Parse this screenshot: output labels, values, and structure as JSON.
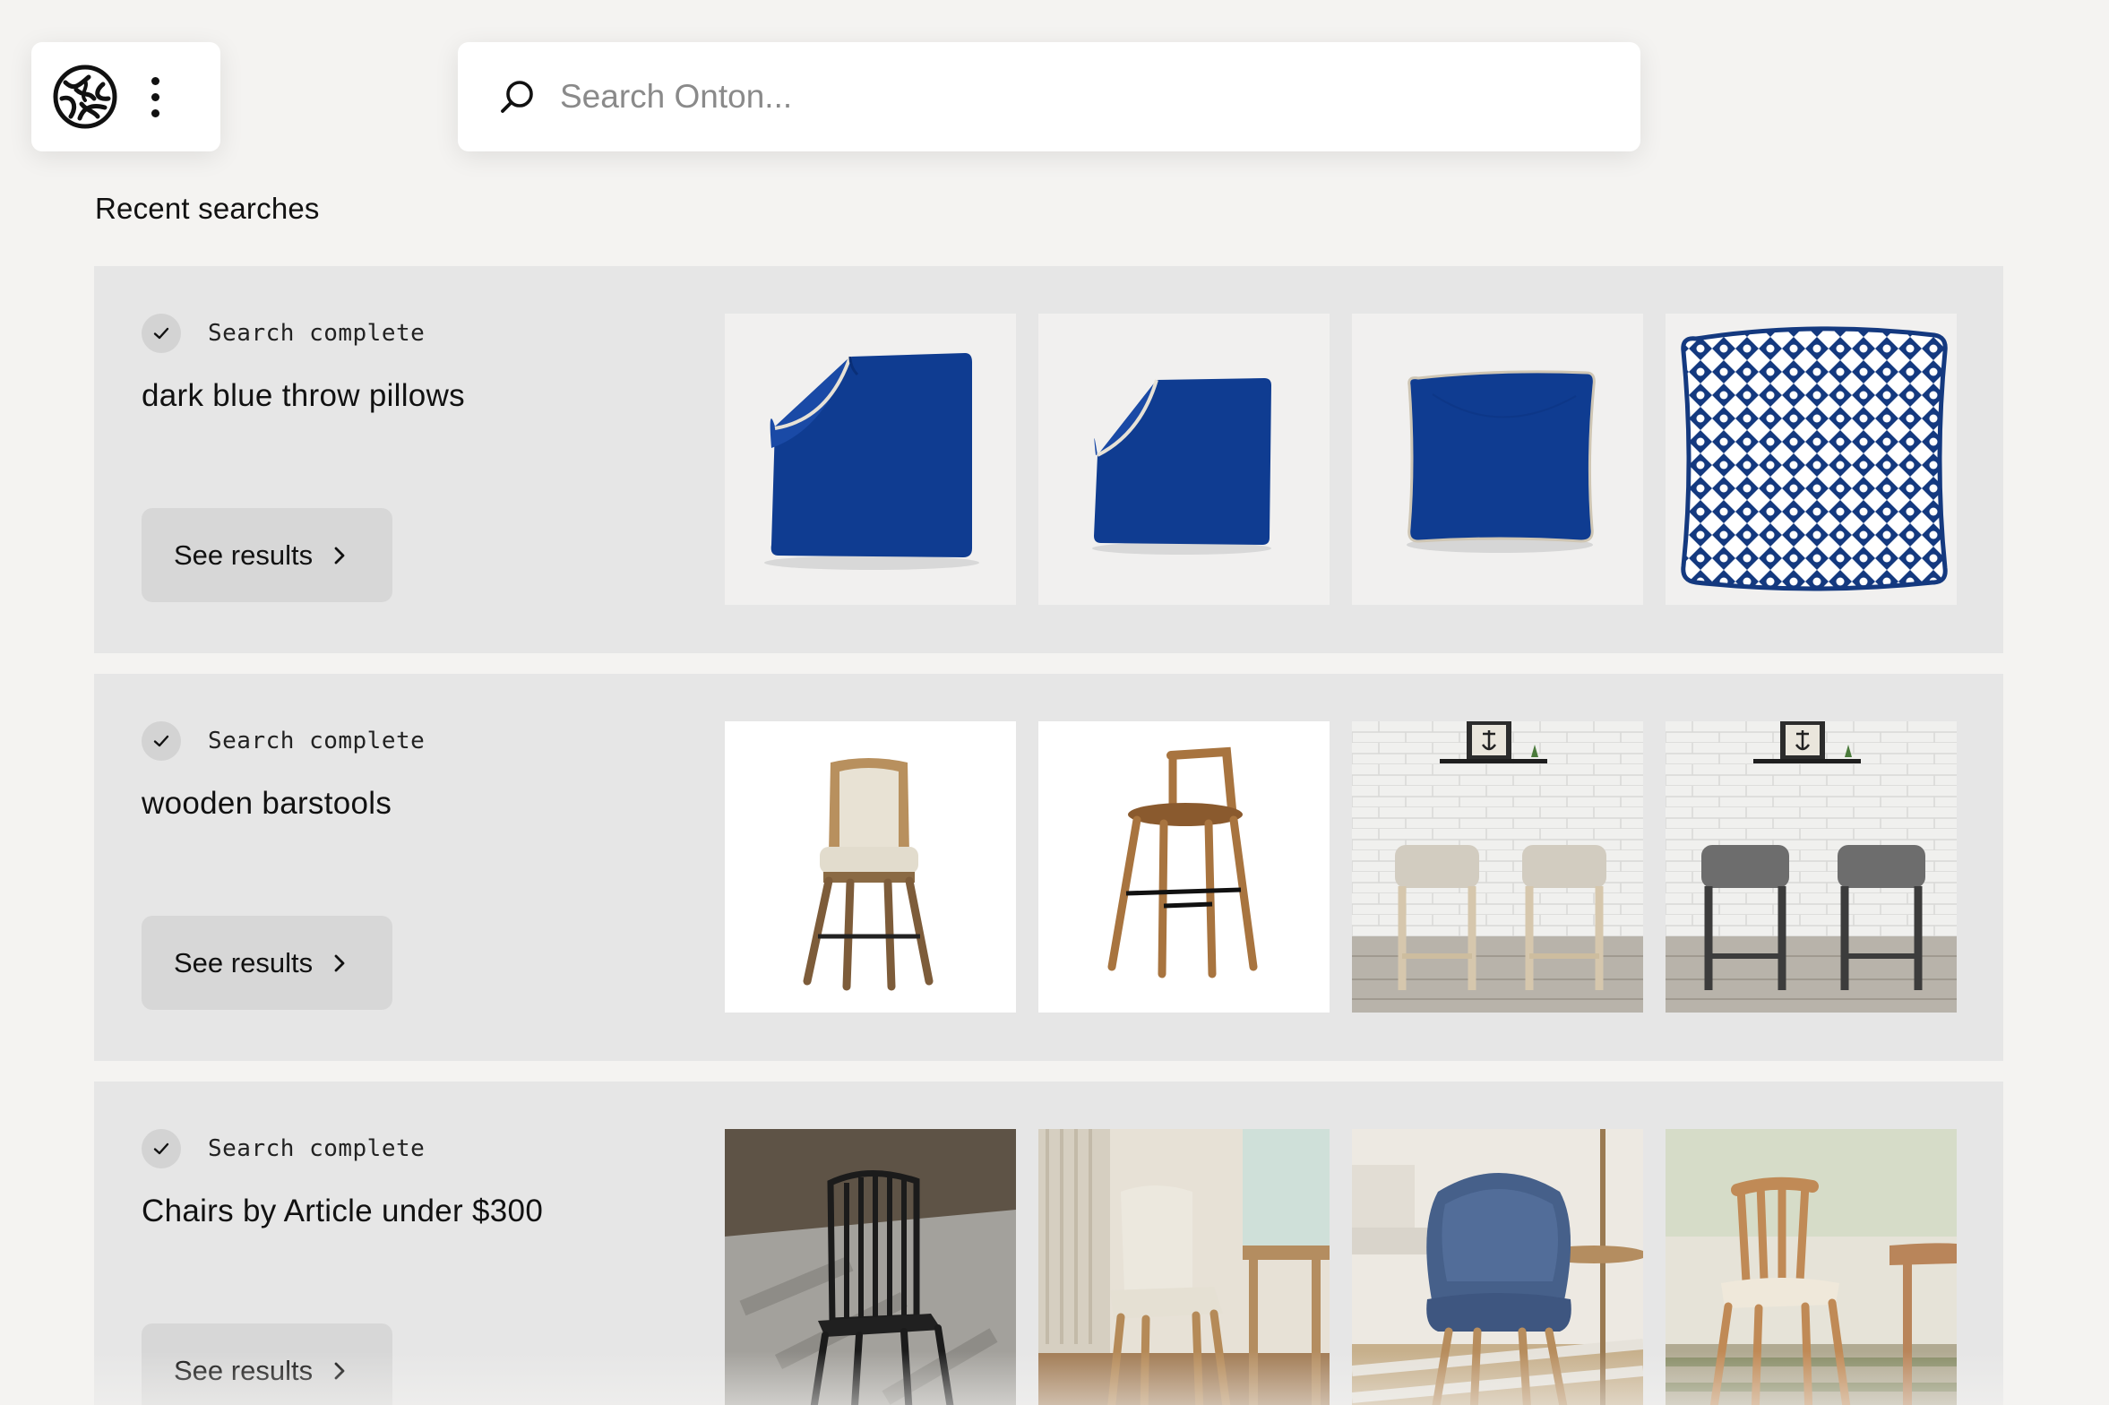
{
  "search": {
    "placeholder": "Search Onton..."
  },
  "icons": {
    "logo": "onton-logo-mark",
    "menu": "kebab-menu-icon",
    "search": "search-icon",
    "check": "check-icon",
    "chevron": "chevron-right-icon"
  },
  "recent": {
    "title": "Recent searches",
    "cards": [
      {
        "status": "Search complete",
        "query": "dark blue throw pillows",
        "button_label": "See results",
        "thumbnails": [
          "navy-pillow-cover-folded",
          "navy-pillow-cover-small",
          "navy-square-pillow",
          "navy-lattice-pattern-pillow"
        ]
      },
      {
        "status": "Search complete",
        "query": "wooden barstools",
        "button_label": "See results",
        "thumbnails": [
          "upholstered-swivel-barstool",
          "wooden-barstool-footrest",
          "beige-saddle-barstools-pair",
          "gray-saddle-barstools-pair"
        ]
      },
      {
        "status": "Search complete",
        "query": "Chairs by Article under $300",
        "button_label": "See results",
        "thumbnails": [
          "black-metal-outdoor-chair",
          "cream-dining-chair",
          "blue-boucle-armchair",
          "oak-spindle-chair"
        ]
      }
    ]
  },
  "colors": {
    "page_bg": "#f4f3f1",
    "card_bg": "#e6e6e6",
    "button_bg": "#d7d7d7",
    "navy": "#0d3a8e"
  }
}
